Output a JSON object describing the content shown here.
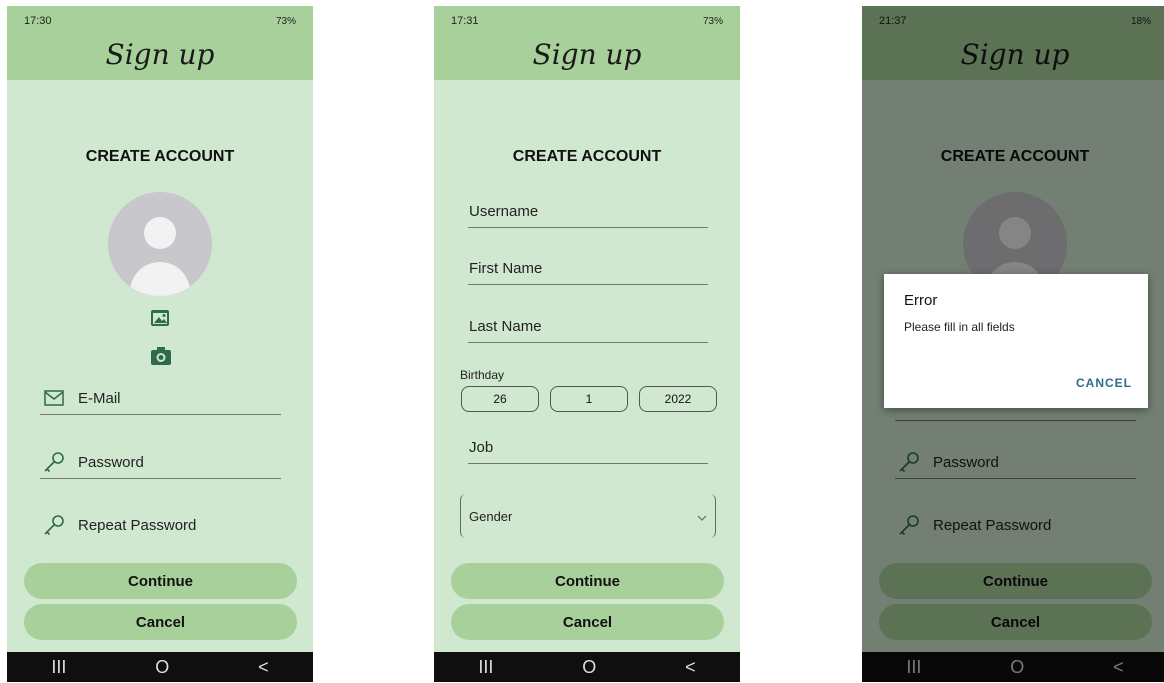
{
  "app": {
    "title": "Sign up",
    "heading": "CREATE ACCOUNT"
  },
  "screens": [
    {
      "status": {
        "time": "17:30",
        "right": "73%"
      },
      "avatar_icon": "person-placeholder-icon",
      "gallery_icon": "image-gallery-icon",
      "camera_icon": "camera-icon",
      "fields": [
        {
          "label": "E-Mail",
          "icon": "mail-icon"
        },
        {
          "label": "Password",
          "icon": "key-icon"
        },
        {
          "label": "Repeat Password",
          "icon": "key-icon"
        }
      ],
      "continue_label": "Continue",
      "cancel_label": "Cancel"
    },
    {
      "status": {
        "time": "17:31",
        "right": "73%"
      },
      "fields": [
        {
          "label": "Username"
        },
        {
          "label": "First Name"
        },
        {
          "label": "Last Name"
        }
      ],
      "birthday": {
        "label": "Birthday",
        "day": "26",
        "month": "1",
        "year": "2022"
      },
      "job_label": "Job",
      "gender": {
        "placeholder": "Gender"
      },
      "continue_label": "Continue",
      "cancel_label": "Cancel"
    },
    {
      "status": {
        "time": "21:37",
        "right": "18%"
      },
      "fields": [
        {
          "label": "Password",
          "icon": "key-icon"
        },
        {
          "label": "Repeat Password",
          "icon": "key-icon"
        }
      ],
      "continue_label": "Continue",
      "cancel_label": "Cancel",
      "dialog": {
        "title": "Error",
        "message": "Please fill in all fields",
        "button": "CANCEL"
      }
    }
  ],
  "navbar": {
    "recent": "III",
    "home": "O",
    "back": "<"
  },
  "colors": {
    "background": "#d0e8cf",
    "header": "#a8d09a",
    "accent_icon": "#2e6b4c",
    "dialog_button": "#2a6f86"
  }
}
